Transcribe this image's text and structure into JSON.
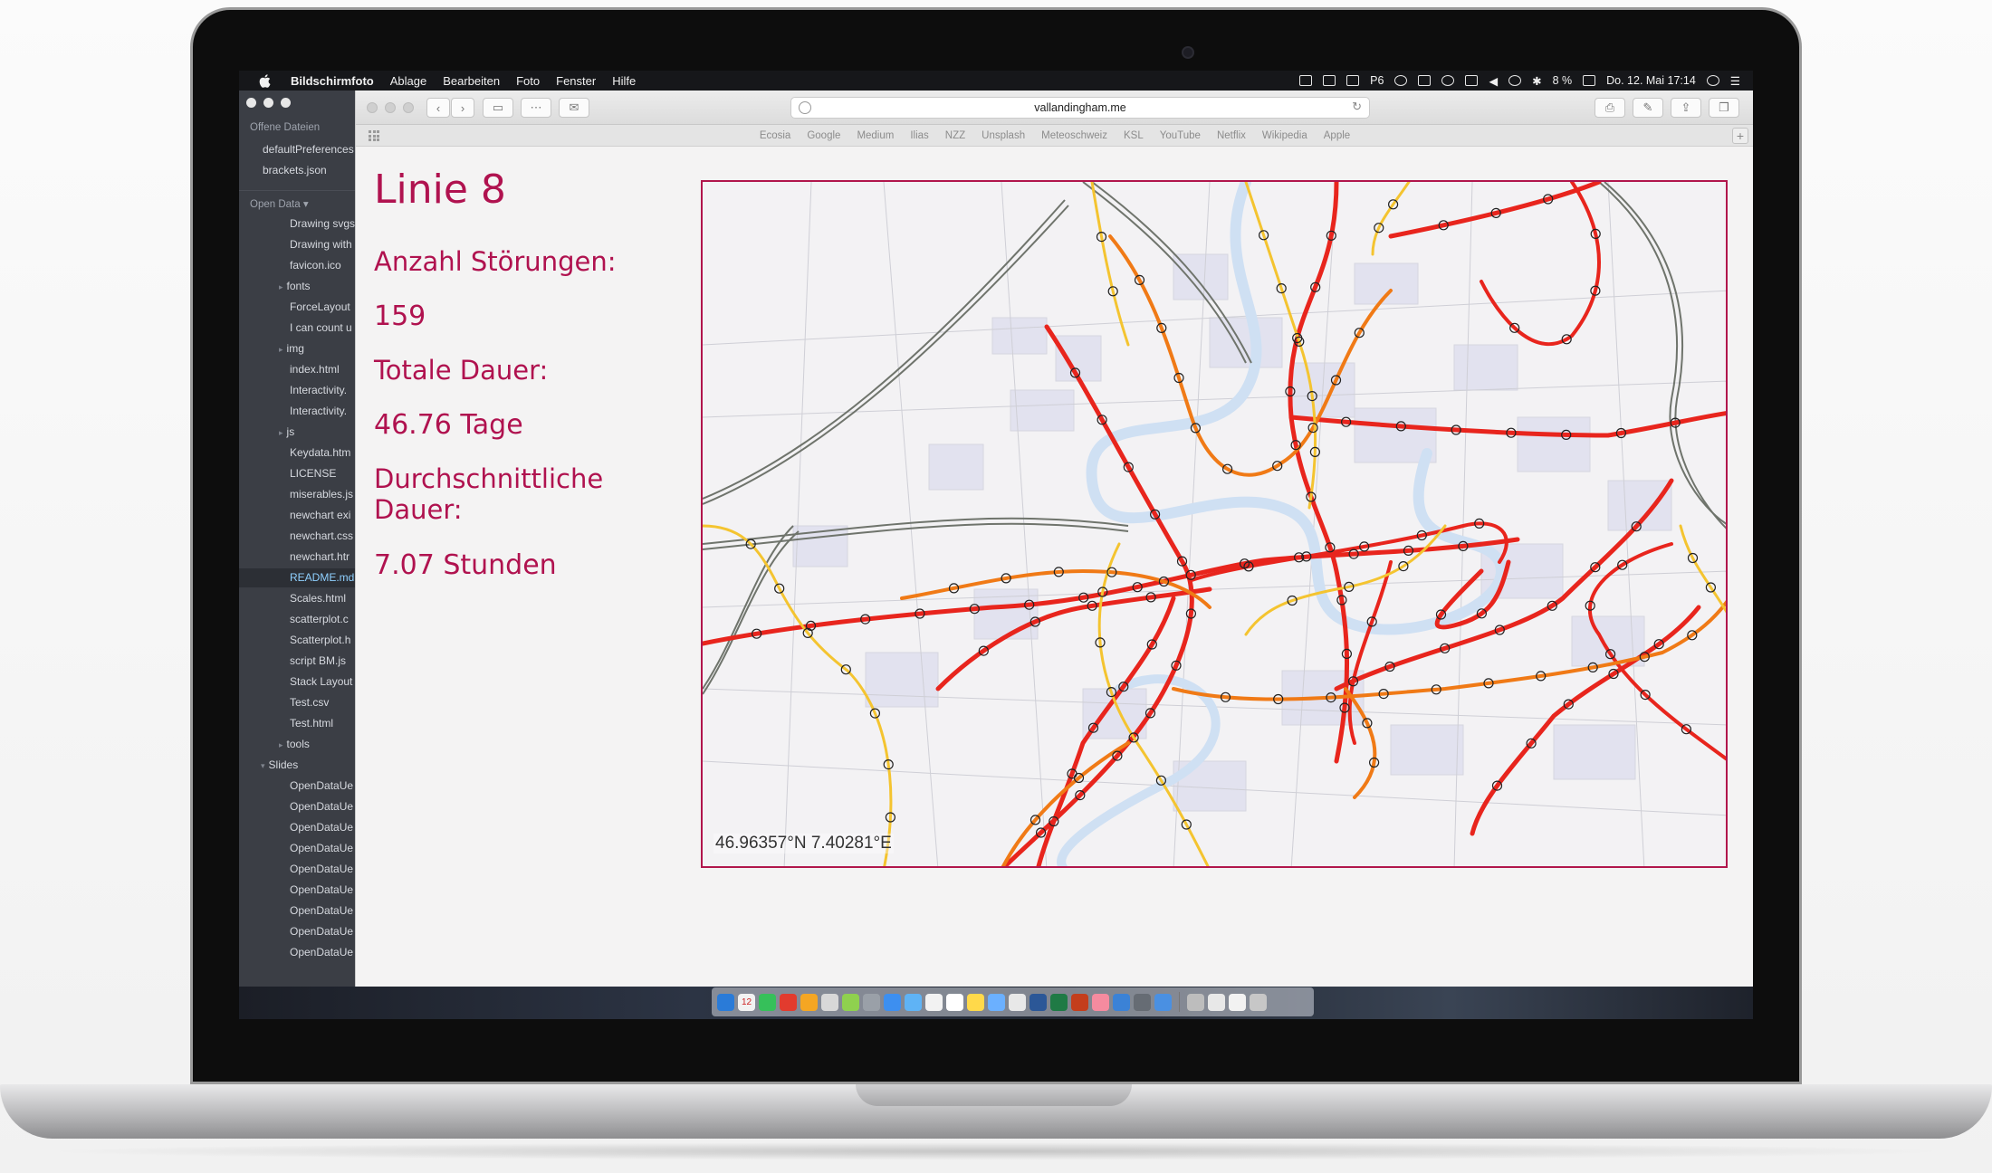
{
  "menubar": {
    "app_name": "Bildschirmfoto",
    "menus": [
      "Ablage",
      "Bearbeiten",
      "Foto",
      "Fenster",
      "Hilfe"
    ],
    "badge": "6",
    "battery": "8 %",
    "datetime": "Do. 12. Mai 17:14"
  },
  "editor": {
    "open_files_header": "Offene Dateien",
    "open_files": [
      "defaultPreferences",
      "brackets.json"
    ],
    "project_header": "Open Data",
    "tree": [
      {
        "label": "Drawing svgs",
        "folder": false
      },
      {
        "label": "Drawing with",
        "folder": false
      },
      {
        "label": "favicon.ico",
        "folder": false
      },
      {
        "label": "fonts",
        "folder": true
      },
      {
        "label": "ForceLayout",
        "folder": false
      },
      {
        "label": "I can count u",
        "folder": false
      },
      {
        "label": "img",
        "folder": true
      },
      {
        "label": "index.html",
        "folder": false
      },
      {
        "label": "Interactivity.",
        "folder": false
      },
      {
        "label": "Interactivity.",
        "folder": false
      },
      {
        "label": "js",
        "folder": true
      },
      {
        "label": "Keydata.htm",
        "folder": false
      },
      {
        "label": "LICENSE",
        "folder": false
      },
      {
        "label": "miserables.js",
        "folder": false
      },
      {
        "label": "newchart exi",
        "folder": false
      },
      {
        "label": "newchart.css",
        "folder": false
      },
      {
        "label": "newchart.htr",
        "folder": false
      },
      {
        "label": "README.md",
        "folder": false,
        "selected": true
      },
      {
        "label": "Scales.html",
        "folder": false
      },
      {
        "label": "scatterplot.c",
        "folder": false
      },
      {
        "label": "Scatterplot.h",
        "folder": false
      },
      {
        "label": "script BM.js",
        "folder": false
      },
      {
        "label": "Stack Layout",
        "folder": false
      },
      {
        "label": "Test.csv",
        "folder": false
      },
      {
        "label": "Test.html",
        "folder": false
      },
      {
        "label": "tools",
        "folder": true
      },
      {
        "label": "Slides",
        "folder": true,
        "open": true
      },
      {
        "label": "OpenDataUe",
        "folder": false
      },
      {
        "label": "OpenDataUe",
        "folder": false
      },
      {
        "label": "OpenDataUe",
        "folder": false
      },
      {
        "label": "OpenDataUe",
        "folder": false
      },
      {
        "label": "OpenDataUe",
        "folder": false
      },
      {
        "label": "OpenDataUe",
        "folder": false
      },
      {
        "label": "OpenDataUe",
        "folder": false
      },
      {
        "label": "OpenDataUe",
        "folder": false
      },
      {
        "label": "OpenDataUe",
        "folder": false
      }
    ]
  },
  "safari": {
    "url": "vallandingham.me",
    "favorites": [
      "Ecosia",
      "Google",
      "Medium",
      "Ilias",
      "NZZ",
      "Unsplash",
      "Meteoschweiz",
      "KSL",
      "YouTube",
      "Netflix",
      "Wikipedia",
      "Apple"
    ]
  },
  "page": {
    "title": "Linie 8",
    "label_count": "Anzahl Störungen:",
    "value_count": "159",
    "label_total": "Totale Dauer:",
    "value_total": "46.76 Tage",
    "label_avg": "Durchschnittliche Dauer:",
    "value_avg": "7.07 Stunden"
  },
  "map": {
    "coordinates": "46.96357°N 7.40281°E",
    "accent_color": "#b1164c",
    "line_colors": {
      "high": "#e8251d",
      "mid": "#f07a16",
      "low": "#f4c430"
    }
  },
  "dock": {
    "calendar_day": "12"
  }
}
